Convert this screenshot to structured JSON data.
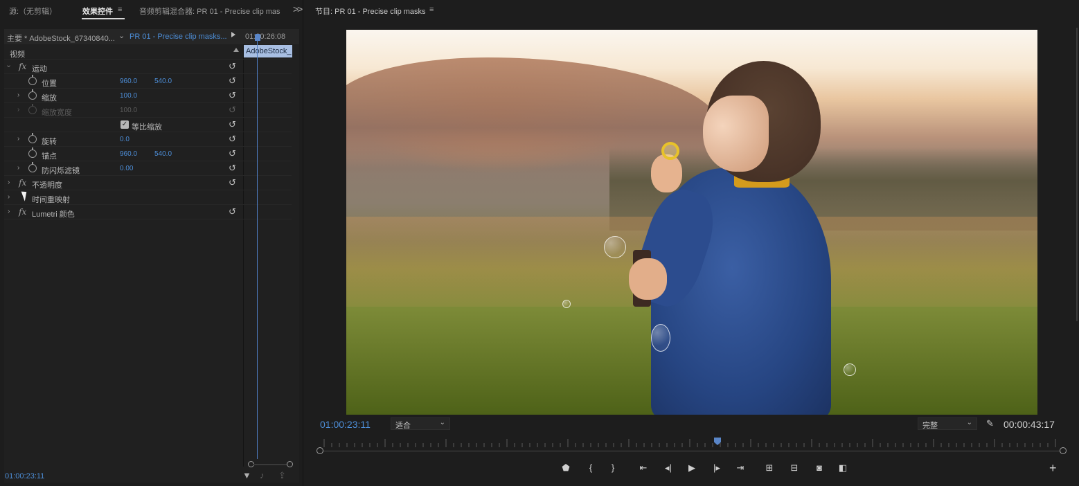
{
  "left_tabs": {
    "source": "源:（无剪辑）",
    "effect_controls": "效果控件",
    "audio_mixer": "音频剪辑混合器: PR 01 - Precise clip mas",
    "overflow": ">>"
  },
  "effect_controls": {
    "master_clip": "主要 * AdobeStock_67340840...",
    "sequence_clip": "PR 01 - Precise clip masks...",
    "timeline_timecode": "01:00:26:08",
    "clip_label": "AdobeStock_",
    "video_section": "视频",
    "rows": {
      "motion": "运动",
      "position": {
        "label": "位置",
        "x": "960.0",
        "y": "540.0"
      },
      "scale": {
        "label": "缩放",
        "value": "100.0"
      },
      "scale_width": {
        "label": "缩放宽度",
        "value": "100.0"
      },
      "uniform_scale": "等比缩放",
      "rotation": {
        "label": "旋转",
        "value": "0.0"
      },
      "anchor": {
        "label": "锚点",
        "x": "960.0",
        "y": "540.0"
      },
      "antiflicker": {
        "label": "防闪烁滤镜",
        "value": "0.00"
      },
      "opacity": "不透明度",
      "time_remap": "时间重映射",
      "lumetri": "Lumetri 颜色"
    },
    "fx_glyph": "fx",
    "footer_timecode": "01:00:23:11"
  },
  "program": {
    "title": "节目: PR 01 - Precise clip masks",
    "current_timecode": "01:00:23:11",
    "zoom_select": "适合",
    "quality_select": "完整",
    "duration": "00:00:43:17"
  },
  "icons": {
    "menu": "≡",
    "reset": "↺",
    "wrench": "🔧",
    "chevron": "›",
    "caret": "⌄",
    "plus": "+"
  },
  "colors": {
    "accent_blue": "#4d8ed8",
    "background": "#1d1d1d"
  }
}
